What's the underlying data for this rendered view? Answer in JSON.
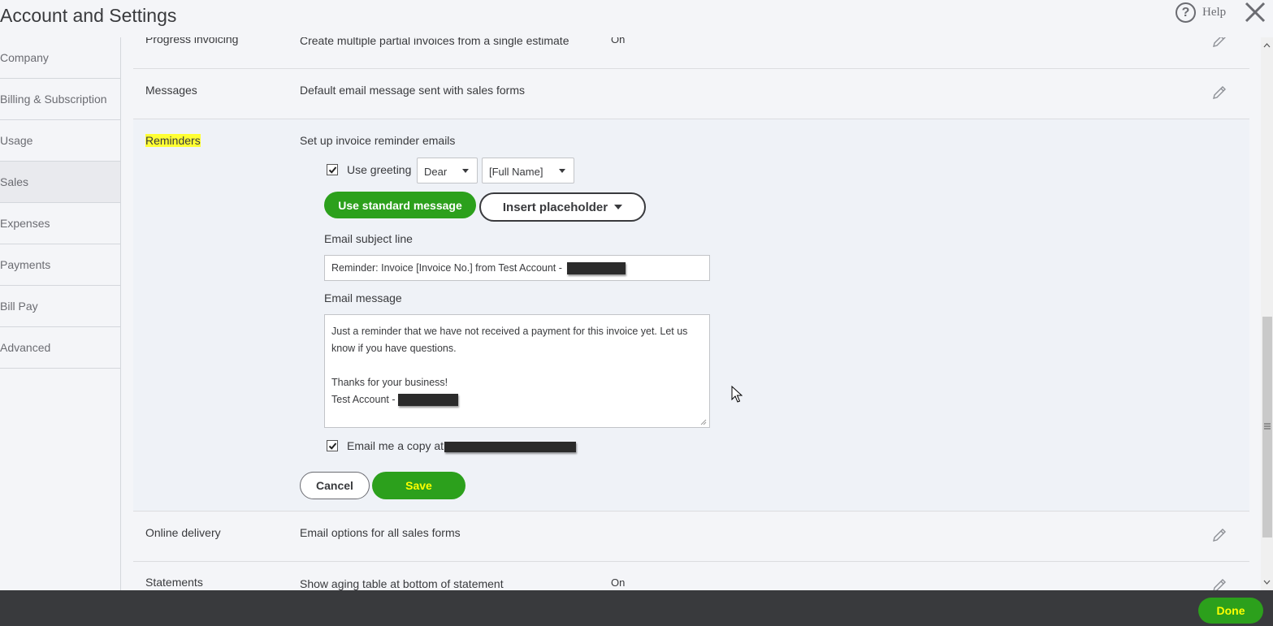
{
  "header": {
    "title": "Account and Settings",
    "help_label": "Help"
  },
  "sidebar": {
    "items": [
      {
        "label": "Company"
      },
      {
        "label": "Billing & Subscription"
      },
      {
        "label": "Usage"
      },
      {
        "label": "Sales",
        "active": true
      },
      {
        "label": "Expenses"
      },
      {
        "label": "Payments"
      },
      {
        "label": "Bill Pay"
      },
      {
        "label": "Advanced"
      }
    ]
  },
  "rows": {
    "progress_invoicing": {
      "label": "Progress invoicing",
      "desc": "Create multiple partial invoices from a single estimate",
      "status": "On"
    },
    "messages": {
      "label": "Messages",
      "desc": "Default email message sent with sales forms"
    },
    "reminders": {
      "label": "Reminders",
      "desc": "Set up invoice reminder emails",
      "use_greeting_label": "Use greeting",
      "use_greeting_checked": true,
      "greeting_value": "Dear",
      "name_value": "[Full Name]",
      "standard_button": "Use standard message",
      "placeholder_button": "Insert placeholder",
      "subject_label": "Email subject line",
      "subject_value": "Reminder: Invoice [Invoice No.] from Test Account -",
      "message_label": "Email message",
      "message_body": "Just a reminder that we have not received a payment for this invoice yet. Let us know if you have questions.\n\nThanks for your business!\nTest Account -",
      "copy_label": "Email me a copy at",
      "copy_checked": true,
      "cancel_label": "Cancel",
      "save_label": "Save"
    },
    "online_delivery": {
      "label": "Online delivery",
      "desc": "Email options for all sales forms"
    },
    "statements": {
      "label": "Statements",
      "desc": "Show aging table at bottom of statement",
      "status": "On"
    }
  },
  "footer": {
    "done_label": "Done"
  },
  "colors": {
    "accent_green": "#2ca01c",
    "highlight": "#ffff33",
    "footer_bg": "#393a3d"
  }
}
